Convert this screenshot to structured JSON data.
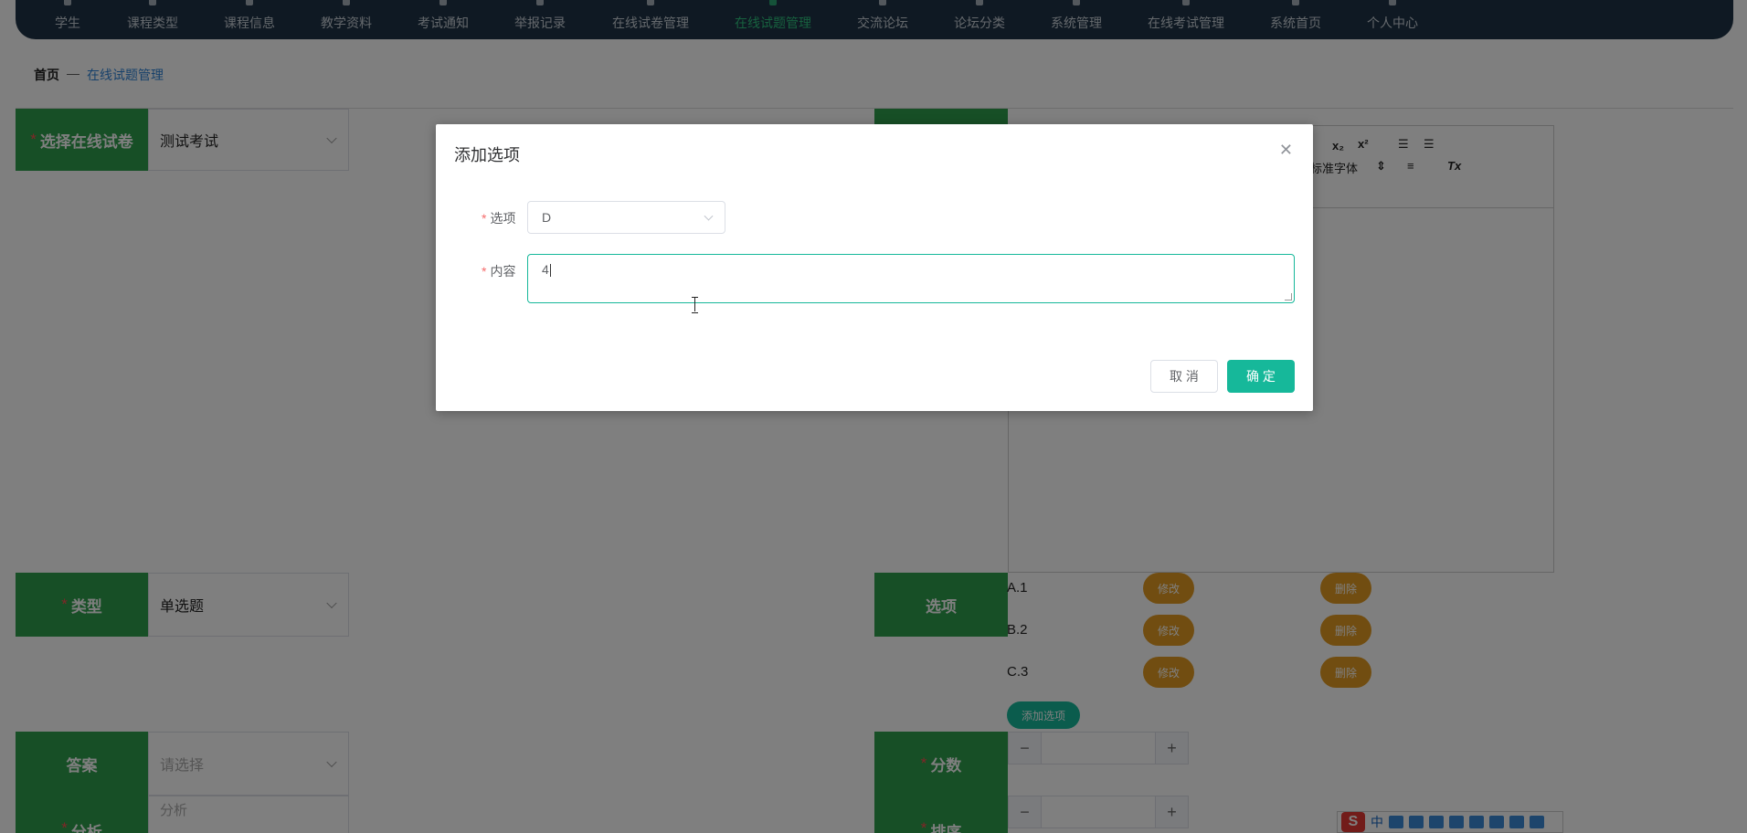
{
  "nav": {
    "items": [
      {
        "label": "学生"
      },
      {
        "label": "课程类型"
      },
      {
        "label": "课程信息"
      },
      {
        "label": "教学资料"
      },
      {
        "label": "考试通知"
      },
      {
        "label": "举报记录"
      },
      {
        "label": "在线试卷管理"
      },
      {
        "label": "在线试题管理"
      },
      {
        "label": "交流论坛"
      },
      {
        "label": "论坛分类"
      },
      {
        "label": "系统管理"
      },
      {
        "label": "在线考试管理"
      },
      {
        "label": "系统首页"
      },
      {
        "label": "个人中心"
      }
    ],
    "active_index": 7,
    "accent_color": "#2ec27e"
  },
  "breadcrumb": {
    "home": "首页",
    "separator": "—",
    "current": "在线试题管理"
  },
  "form": {
    "paper_label": "选择在线试卷",
    "paper_value": "测试考试",
    "type_label": "类型",
    "type_value": "单选题",
    "options_label": "选项",
    "answer_label": "答案",
    "answer_placeholder": "请选择",
    "analysis_label": "分析",
    "analysis_placeholder": "分析",
    "score_label": "分数",
    "order_label": "排序",
    "options": [
      {
        "text": "A.1",
        "edit": "修改",
        "delete": "删除"
      },
      {
        "text": "B.2",
        "edit": "修改",
        "delete": "删除"
      },
      {
        "text": "C.3",
        "edit": "修改",
        "delete": "删除"
      }
    ],
    "add_option_button": "添加选项",
    "editor_font_label": "标准字体"
  },
  "modal": {
    "title": "添加选项",
    "option_label": "选项",
    "option_value": "D",
    "content_label": "内容",
    "content_value": "4",
    "cancel_button": "取 消",
    "confirm_button": "确 定",
    "accent_color": "#16b89a"
  },
  "ime": {
    "logo": "S",
    "mode": "中"
  },
  "icons": [
    "close-icon",
    "chevron-down-icon",
    "text-cursor-icon",
    "subscript-icon",
    "superscript-icon",
    "indent-icon",
    "outdent-icon",
    "align-icon",
    "clear-format-icon",
    "minus-icon",
    "plus-icon",
    "ime-logo-icon"
  ]
}
